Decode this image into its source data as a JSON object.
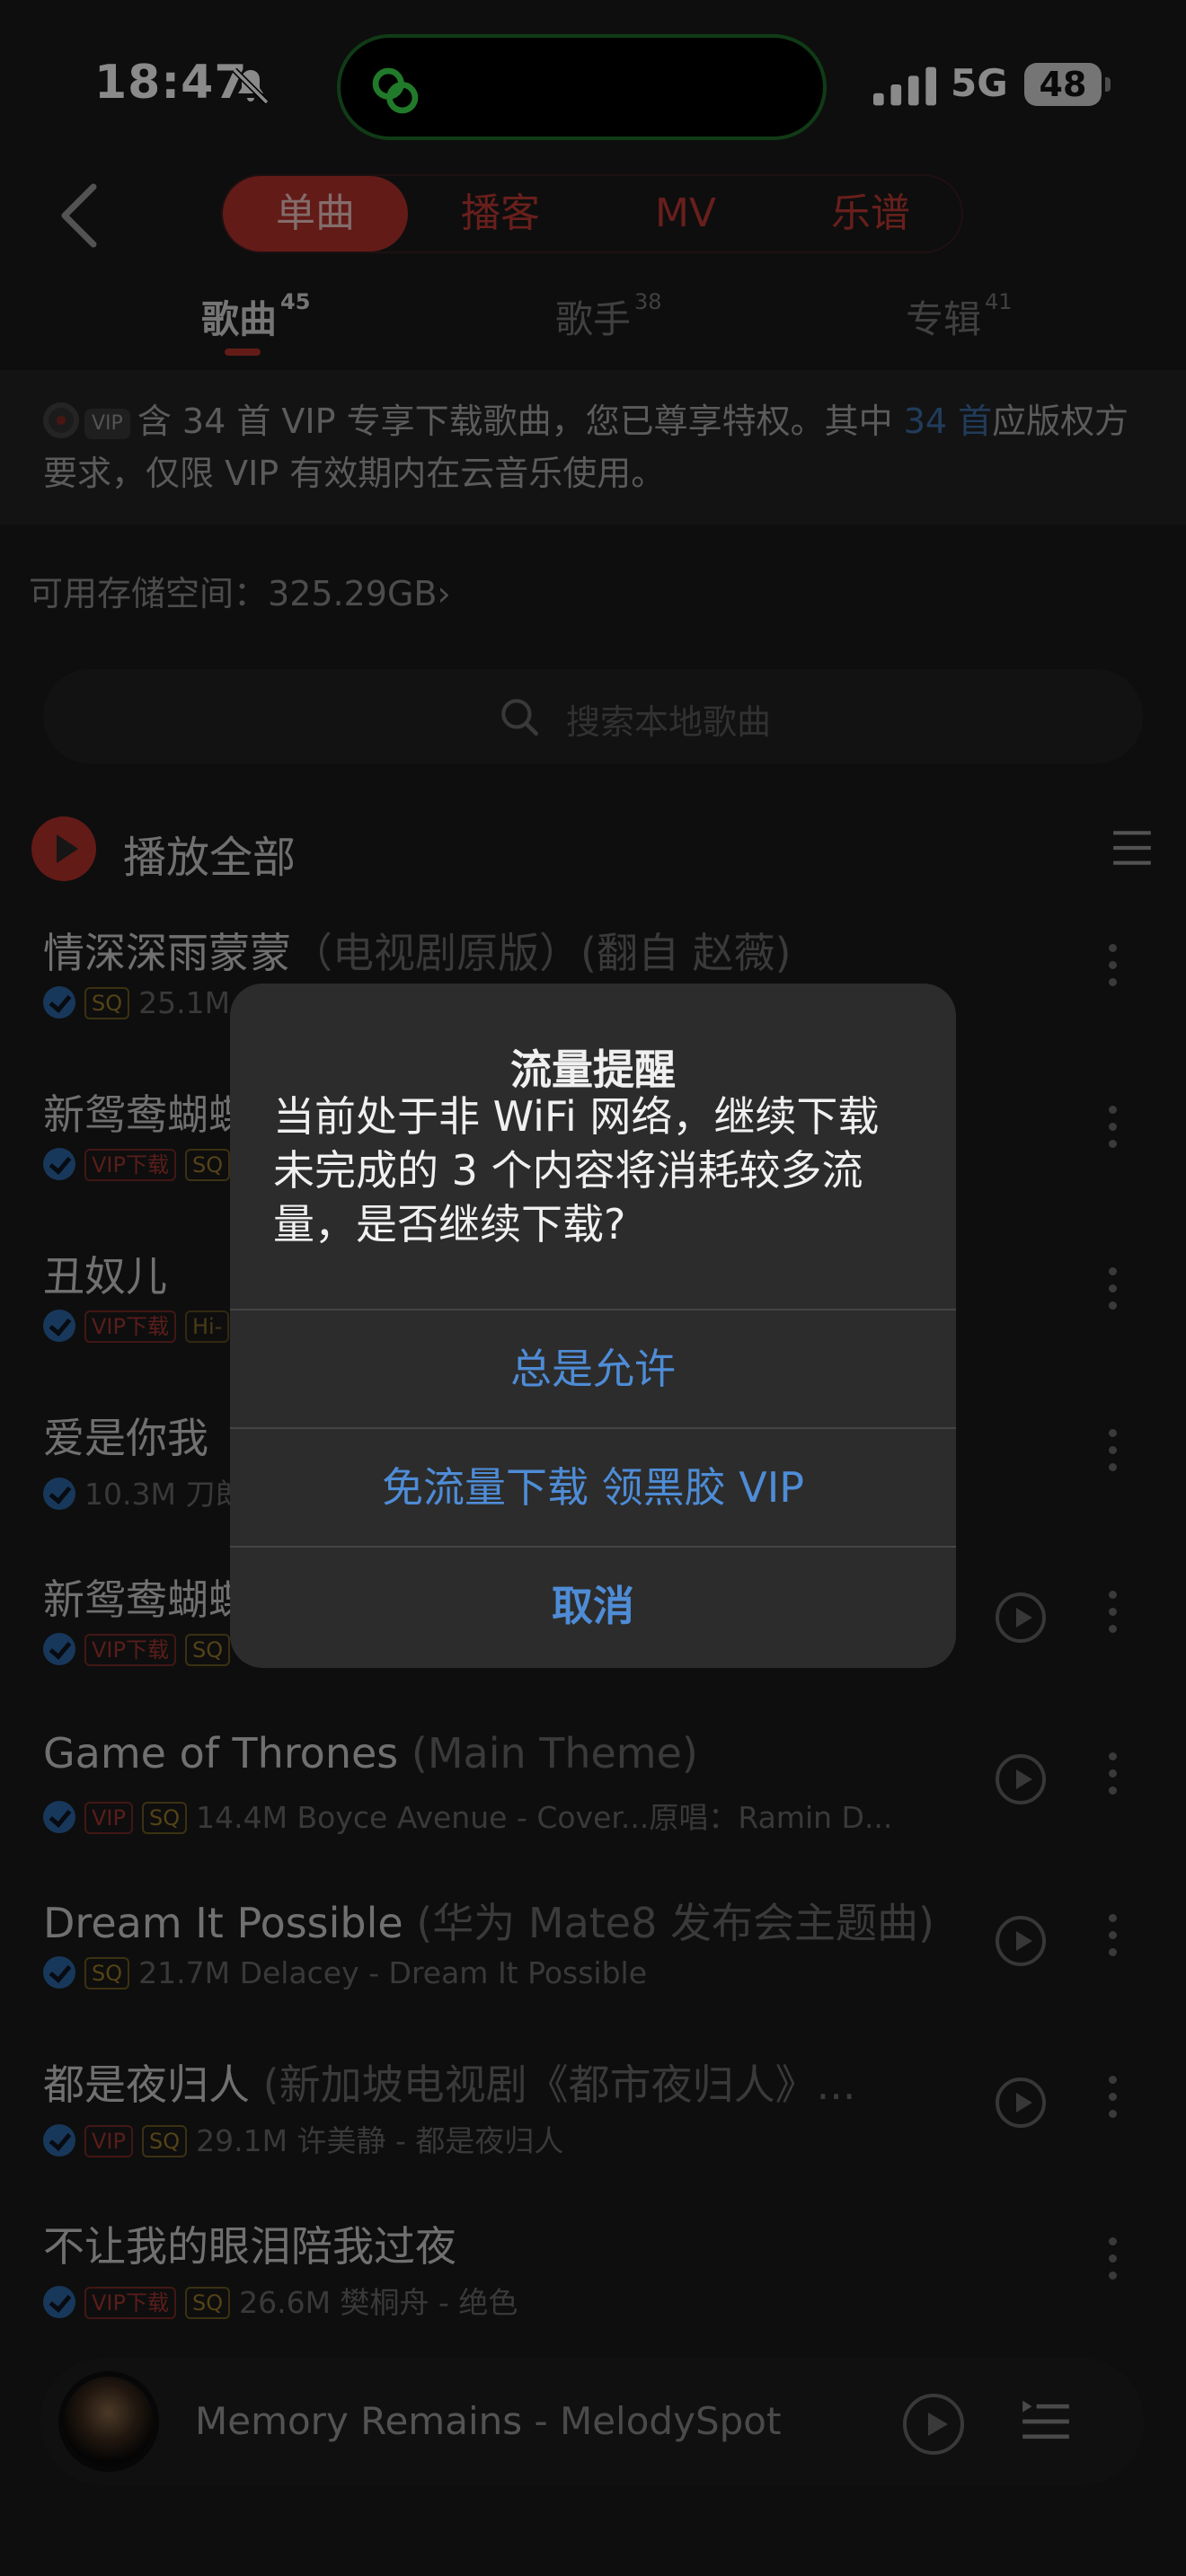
{
  "status_bar": {
    "time": "18:47",
    "network": "5G",
    "battery": "48"
  },
  "segments": [
    {
      "label": "单曲",
      "active": true
    },
    {
      "label": "播客",
      "active": false
    },
    {
      "label": "MV",
      "active": false
    },
    {
      "label": "乐谱",
      "active": false
    }
  ],
  "tabs": [
    {
      "label": "歌曲",
      "count": "45",
      "active": true
    },
    {
      "label": "歌手",
      "count": "38",
      "active": false
    },
    {
      "label": "专辑",
      "count": "41",
      "active": false
    }
  ],
  "notice": {
    "badge": "VIP",
    "text_before": "含 34 首 VIP 专享下载歌曲，您已尊享特权。其中 ",
    "link": "34 首",
    "text_after": "应版权方要求，仅限 VIP 有效期内在云音乐使用。"
  },
  "storage": {
    "label": "可用存储空间：",
    "value": "325.29GB",
    "chevron": "›"
  },
  "search": {
    "placeholder": "搜索本地歌曲"
  },
  "play_all": {
    "label": "播放全部"
  },
  "songs": [
    {
      "title": "情深深雨蒙蒙",
      "sub": "（电视剧原版）(翻自 赵薇)",
      "tags": [
        "SQ"
      ],
      "meta": "25.1M"
    },
    {
      "title": "新鸳鸯蝴蝶",
      "sub": "",
      "tags": [
        "VIP下载",
        "SQ"
      ],
      "meta": ""
    },
    {
      "title": "丑奴儿",
      "sub": "",
      "tags": [
        "VIP下载",
        "Hi-"
      ],
      "meta": ""
    },
    {
      "title": "爱是你我",
      "sub": "",
      "tags": [],
      "meta": "10.3M 刀郎"
    },
    {
      "title": "新鸳鸯蝴蝶",
      "sub": "",
      "tags": [
        "VIP下载",
        "SQ"
      ],
      "meta": ""
    },
    {
      "title": "Game of Thrones",
      "sub": " (Main Theme)",
      "tags": [
        "VIP",
        "SQ"
      ],
      "meta": "14.4M Boyce Avenue - Cover...原唱：Ramin D..."
    },
    {
      "title": "Dream It Possible",
      "sub": " (华为 Mate8 发布会主题曲)",
      "tags": [
        "SQ"
      ],
      "meta": "21.7M Delacey - Dream It Possible"
    },
    {
      "title": "都是夜归人",
      "sub": " (新加坡电视剧《都市夜归人》...",
      "tags": [
        "VIP",
        "SQ"
      ],
      "meta": "29.1M 许美静 - 都是夜归人"
    },
    {
      "title": "不让我的眼泪陪我过夜",
      "sub": "",
      "tags": [
        "VIP下载",
        "SQ"
      ],
      "meta": "26.6M 樊桐舟 - 绝色"
    }
  ],
  "mini_player": {
    "title": "Memory Remains",
    "artist": " - MelodySpot"
  },
  "dialog": {
    "title": "流量提醒",
    "message": "当前处于非 WiFi 网络，继续下载未完成的 3 个内容将消耗较多流量，是否继续下载?",
    "buttons": [
      "总是允许",
      "免流量下载 领黑胶 VIP",
      "取消"
    ]
  },
  "colors": {
    "accent_red": "#b8322c",
    "link_blue": "#4e8cd6",
    "dialog_bg": "#2c2c2c"
  }
}
